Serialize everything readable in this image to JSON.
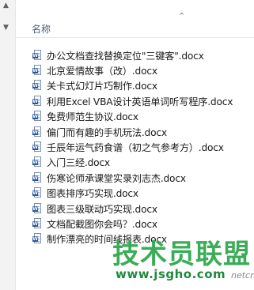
{
  "header": {
    "column_name": "名称",
    "sort_indicator_icon": "chevron-up-icon"
  },
  "files": [
    {
      "name": "办公文档查找替换定位\"三键客\".docx",
      "icon": "word-doc-icon"
    },
    {
      "name": "北京爱情故事（改）.docx",
      "icon": "word-doc-icon"
    },
    {
      "name": "关卡式幻灯片巧制作.docx",
      "icon": "word-doc-icon"
    },
    {
      "name": "利用Excel VBA设计英语单词听写程序.docx",
      "icon": "word-doc-icon"
    },
    {
      "name": "免费师范生协议.docx",
      "icon": "word-doc-icon"
    },
    {
      "name": "偏门而有趣的手机玩法.docx",
      "icon": "word-doc-icon"
    },
    {
      "name": "壬辰年运气药食谱（初之气参考方）.docx",
      "icon": "word-doc-icon"
    },
    {
      "name": "入门三经.docx",
      "icon": "word-doc-icon"
    },
    {
      "name": "伤寒论师承课堂实录刘志杰.docx",
      "icon": "word-doc-icon"
    },
    {
      "name": "图表排序巧实现.docx",
      "icon": "word-doc-icon"
    },
    {
      "name": "图表三级联动巧实现.docx",
      "icon": "word-doc-icon"
    },
    {
      "name": "文档配截图你会吗？.docx",
      "icon": "word-doc-icon"
    },
    {
      "name": "制作漂亮的时间线报表.docx",
      "icon": "word-doc-icon"
    }
  ],
  "watermark": {
    "logo_text": "技术员联盟",
    "url": "www.jsgho.com",
    "tag": "netcn"
  },
  "colors": {
    "header_text": "#4c607a",
    "word_badge": "#2b579a",
    "watermark_green": "#2ba64a"
  }
}
